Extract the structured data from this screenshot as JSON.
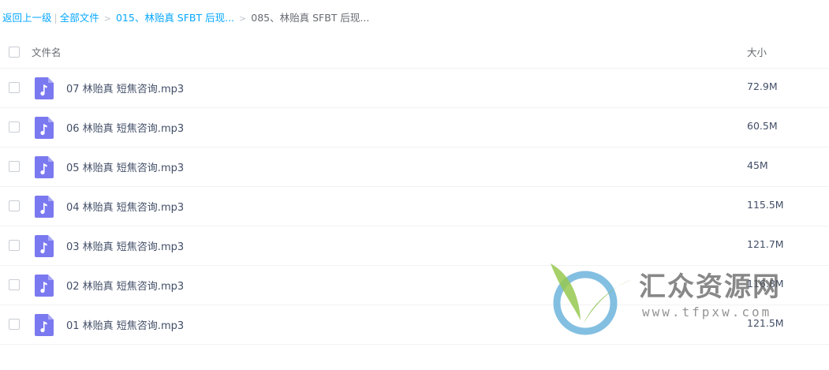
{
  "breadcrumb": {
    "back": "返回上一级",
    "separator": "|",
    "root": "全部文件",
    "level1": "015、林贻真 SFBT 后现...",
    "current": "085、林贻真 SFBT 后现..."
  },
  "table": {
    "col_name": "文件名",
    "col_size": "大小"
  },
  "files": [
    {
      "name": "07 林贻真 短焦咨询.mp3",
      "size": "72.9M"
    },
    {
      "name": "06 林贻真 短焦咨询.mp3",
      "size": "60.5M"
    },
    {
      "name": "05 林贻真 短焦咨询.mp3",
      "size": "45M"
    },
    {
      "name": "04 林贻真 短焦咨询.mp3",
      "size": "115.5M"
    },
    {
      "name": "03 林贻真 短焦咨询.mp3",
      "size": "121.7M"
    },
    {
      "name": "02 林贻真 短焦咨询.mp3",
      "size": "116.8M"
    },
    {
      "name": "01 林贻真 短焦咨询.mp3",
      "size": "121.5M"
    }
  ],
  "icons": {
    "file_type": "music-file-icon",
    "breadcrumb_arrow": "chevron-right-icon"
  },
  "colors": {
    "link": "#06a7ff",
    "audio_icon": "#7b79f0",
    "text": "#424e67"
  },
  "watermark": {
    "title": "汇众资源网",
    "url": "www.tfpxw.com"
  }
}
